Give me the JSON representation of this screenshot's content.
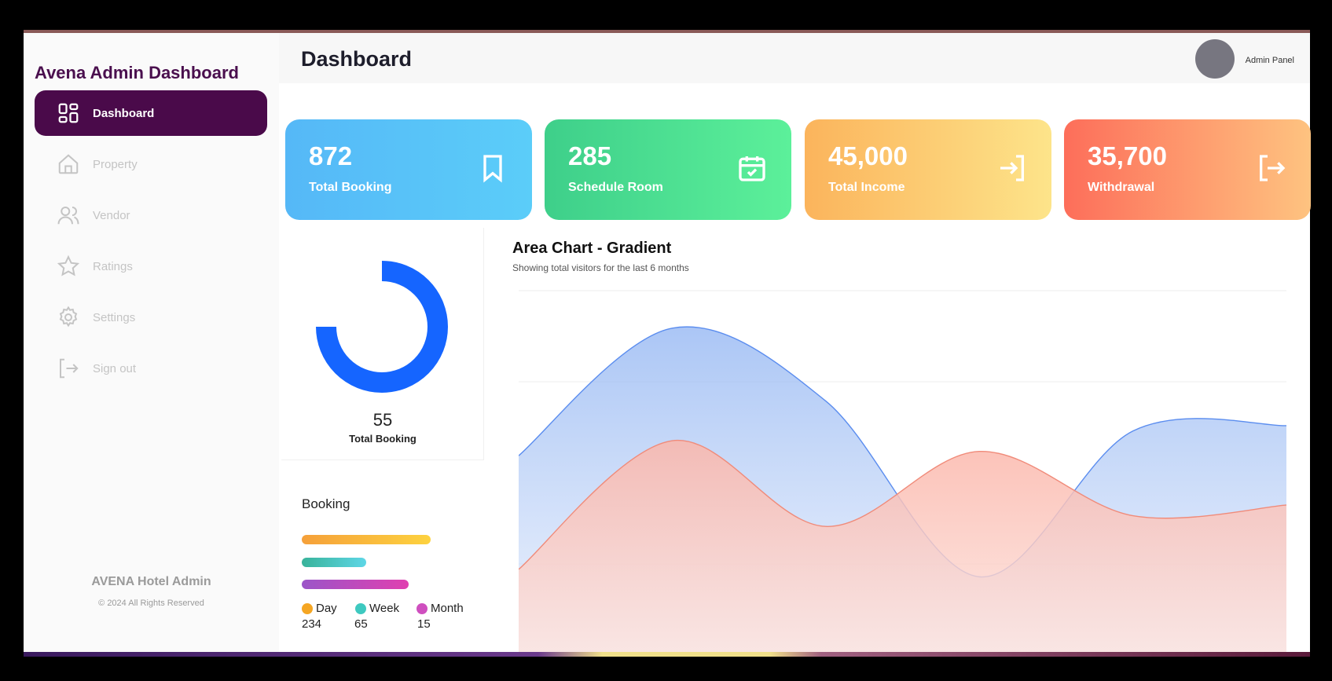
{
  "sidebar": {
    "brand": "Avena Admin Dashboard",
    "items": [
      {
        "label": "Dashboard",
        "icon": "grid-icon",
        "active": true
      },
      {
        "label": "Property",
        "icon": "home-icon",
        "active": false
      },
      {
        "label": "Vendor",
        "icon": "users-icon",
        "active": false
      },
      {
        "label": "Ratings",
        "icon": "star-icon",
        "active": false
      },
      {
        "label": "Settings",
        "icon": "gear-icon",
        "active": false
      },
      {
        "label": "Sign out",
        "icon": "signout-icon",
        "active": false
      }
    ],
    "footer_title": "AVENA Hotel Admin",
    "footer_copy": "© 2024 All Rights Reserved"
  },
  "header": {
    "title": "Dashboard",
    "admin_label": "Admin Panel"
  },
  "stats": [
    {
      "value": "872",
      "label": "Total Booking",
      "icon": "bookmark-icon"
    },
    {
      "value": "285",
      "label": "Schedule Room",
      "icon": "calendar-check-icon"
    },
    {
      "value": "45,000",
      "label": "Total Income",
      "icon": "login-icon"
    },
    {
      "value": "35,700",
      "label": "Withdrawal",
      "icon": "logout-icon"
    }
  ],
  "donut": {
    "value": "55",
    "label": "Total Booking",
    "fraction": 0.75,
    "color": "#1565ff"
  },
  "booking": {
    "title": "Booking",
    "legend": [
      {
        "name": "Day",
        "value": "234",
        "color": "#f5a623"
      },
      {
        "name": "Week",
        "value": "65",
        "color": "#3ec9c0"
      },
      {
        "name": "Month",
        "value": "15",
        "color": "#cf4fbf"
      }
    ]
  },
  "chart": {
    "title": "Area Chart - Gradient",
    "subtitle": "Showing total visitors for the last 6 months"
  },
  "chart_data": {
    "type": "area",
    "title": "Area Chart - Gradient",
    "subtitle": "Showing total visitors for the last 6 months",
    "x": [
      0,
      1,
      2,
      3,
      4,
      5
    ],
    "series": [
      {
        "values": [
          186,
          305,
          237,
          73,
          209,
          214
        ],
        "color": "#5b8def"
      },
      {
        "values": [
          80,
          200,
          120,
          190,
          130,
          140
        ],
        "color": "#f08b7a"
      }
    ],
    "ylim": [
      0,
      340
    ],
    "grid": true
  }
}
